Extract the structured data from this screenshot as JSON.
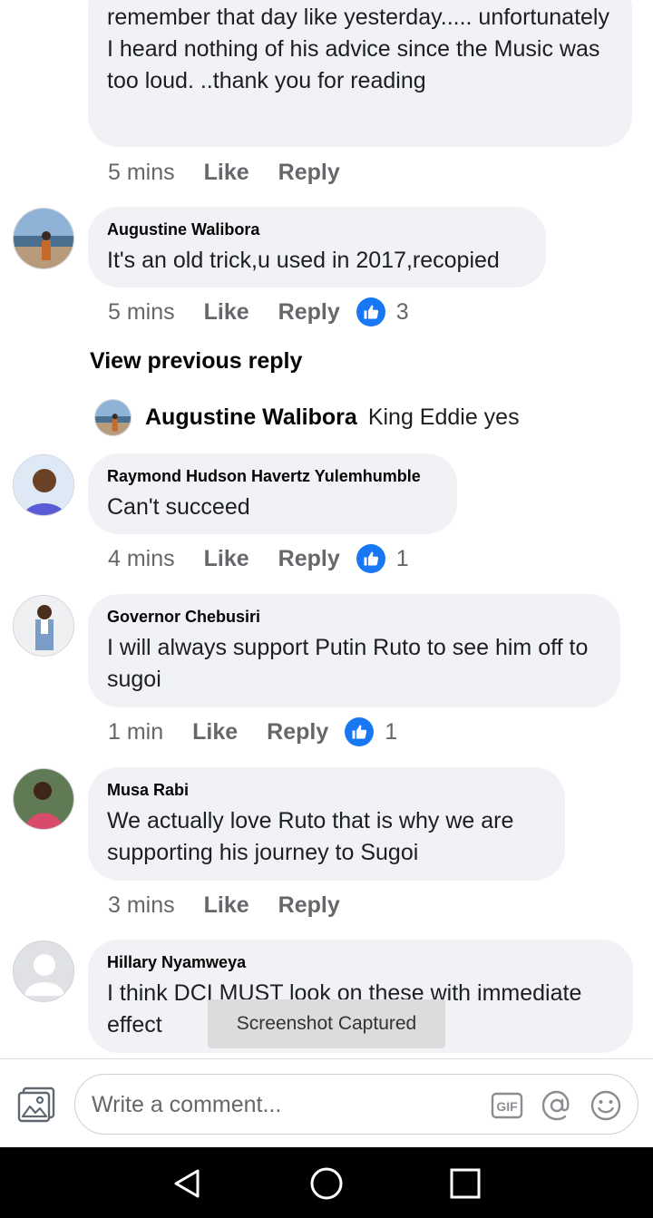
{
  "comments": [
    {
      "text": "remember that day like yesterday..... unfortunately I heard nothing of his advice since the Music was too loud. ..thank you for reading",
      "time": "5 mins",
      "like": "Like",
      "reply": "Reply"
    },
    {
      "author": "Augustine Walibora",
      "text": "It's an old trick,u used in 2017,recopied",
      "time": "5 mins",
      "like": "Like",
      "reply": "Reply",
      "reactions": "3"
    },
    {
      "author": "Raymond Hudson Havertz Yulemhumble",
      "text": "Can't succeed",
      "time": "4 mins",
      "like": "Like",
      "reply": "Reply",
      "reactions": "1"
    },
    {
      "author": "Governor Chebusiri",
      "text": "I will always support Putin Ruto to see him off to sugoi",
      "time": "1 min",
      "like": "Like",
      "reply": "Reply",
      "reactions": "1"
    },
    {
      "author": "Musa Rabi",
      "text": "We actually love Ruto that is  why we are supporting his journey to Sugoi",
      "time": "3 mins",
      "like": "Like",
      "reply": "Reply"
    },
    {
      "author": "Hillary Nyamweya",
      "text": "I think DCI MUST look on these with immediate effect"
    }
  ],
  "view_previous": "View previous reply",
  "reply_preview": {
    "author": "Augustine Walibora",
    "text": "King Eddie yes"
  },
  "toast": "Screenshot Captured",
  "composer": {
    "placeholder": "Write a comment..."
  },
  "icons": {
    "photo": "photo-icon",
    "gif": "gif-icon",
    "mention": "at-icon",
    "emoji": "emoji-icon",
    "back": "back-triangle-icon",
    "home": "home-circle-icon",
    "recents": "recents-square-icon"
  },
  "colors": {
    "bubble": "#f0f2f5",
    "like_blue": "#1877f2",
    "meta_gray": "#65676b",
    "navbar": "#000000"
  }
}
